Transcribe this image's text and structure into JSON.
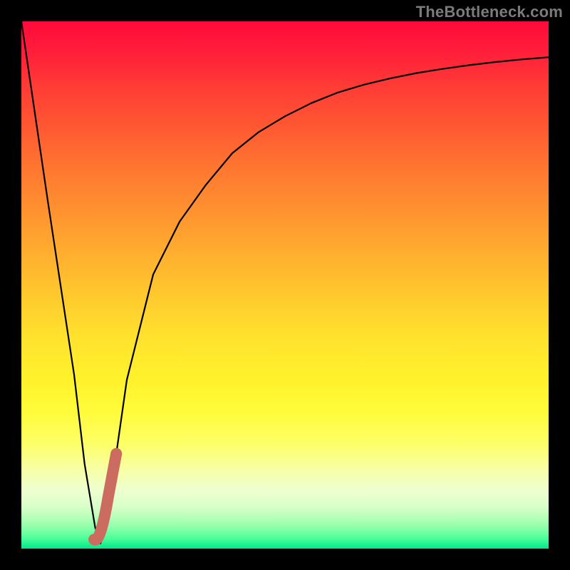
{
  "watermark": "TheBottleneck.com",
  "colors": {
    "frame_bg": "#000000",
    "curve": "#000000",
    "marker": "#cc6b5f",
    "gradient_top": "#ff0a3a",
    "gradient_bottom": "#00e88a"
  },
  "chart_data": {
    "type": "line",
    "title": "",
    "xlabel": "",
    "ylabel": "",
    "xlim": [
      0,
      100
    ],
    "ylim": [
      0,
      100
    ],
    "grid": false,
    "series": [
      {
        "name": "bottleneck-curve",
        "x": [
          0,
          5,
          10,
          12,
          14,
          15,
          16,
          18,
          20,
          25,
          30,
          35,
          40,
          45,
          50,
          55,
          60,
          65,
          70,
          75,
          80,
          85,
          90,
          95,
          100
        ],
        "y": [
          100,
          66,
          33,
          16,
          4,
          1,
          4,
          18,
          32,
          52,
          62,
          69,
          75,
          79,
          82,
          84.5,
          86.5,
          88,
          89.2,
          90.2,
          91,
          91.7,
          92.3,
          92.8,
          93.2
        ]
      }
    ],
    "marker": {
      "name": "highlight-segment",
      "x_start": 15,
      "x_end": 18,
      "y_start": 2,
      "y_end": 18,
      "color": "#cc6b5f"
    },
    "background_heatmap": {
      "axis": "y",
      "stops": [
        {
          "y": 100,
          "color": "#ff0a3a"
        },
        {
          "y": 60,
          "color": "#ffc92e"
        },
        {
          "y": 35,
          "color": "#fff22c"
        },
        {
          "y": 10,
          "color": "#eeffd0"
        },
        {
          "y": 0,
          "color": "#00e88a"
        }
      ]
    }
  }
}
